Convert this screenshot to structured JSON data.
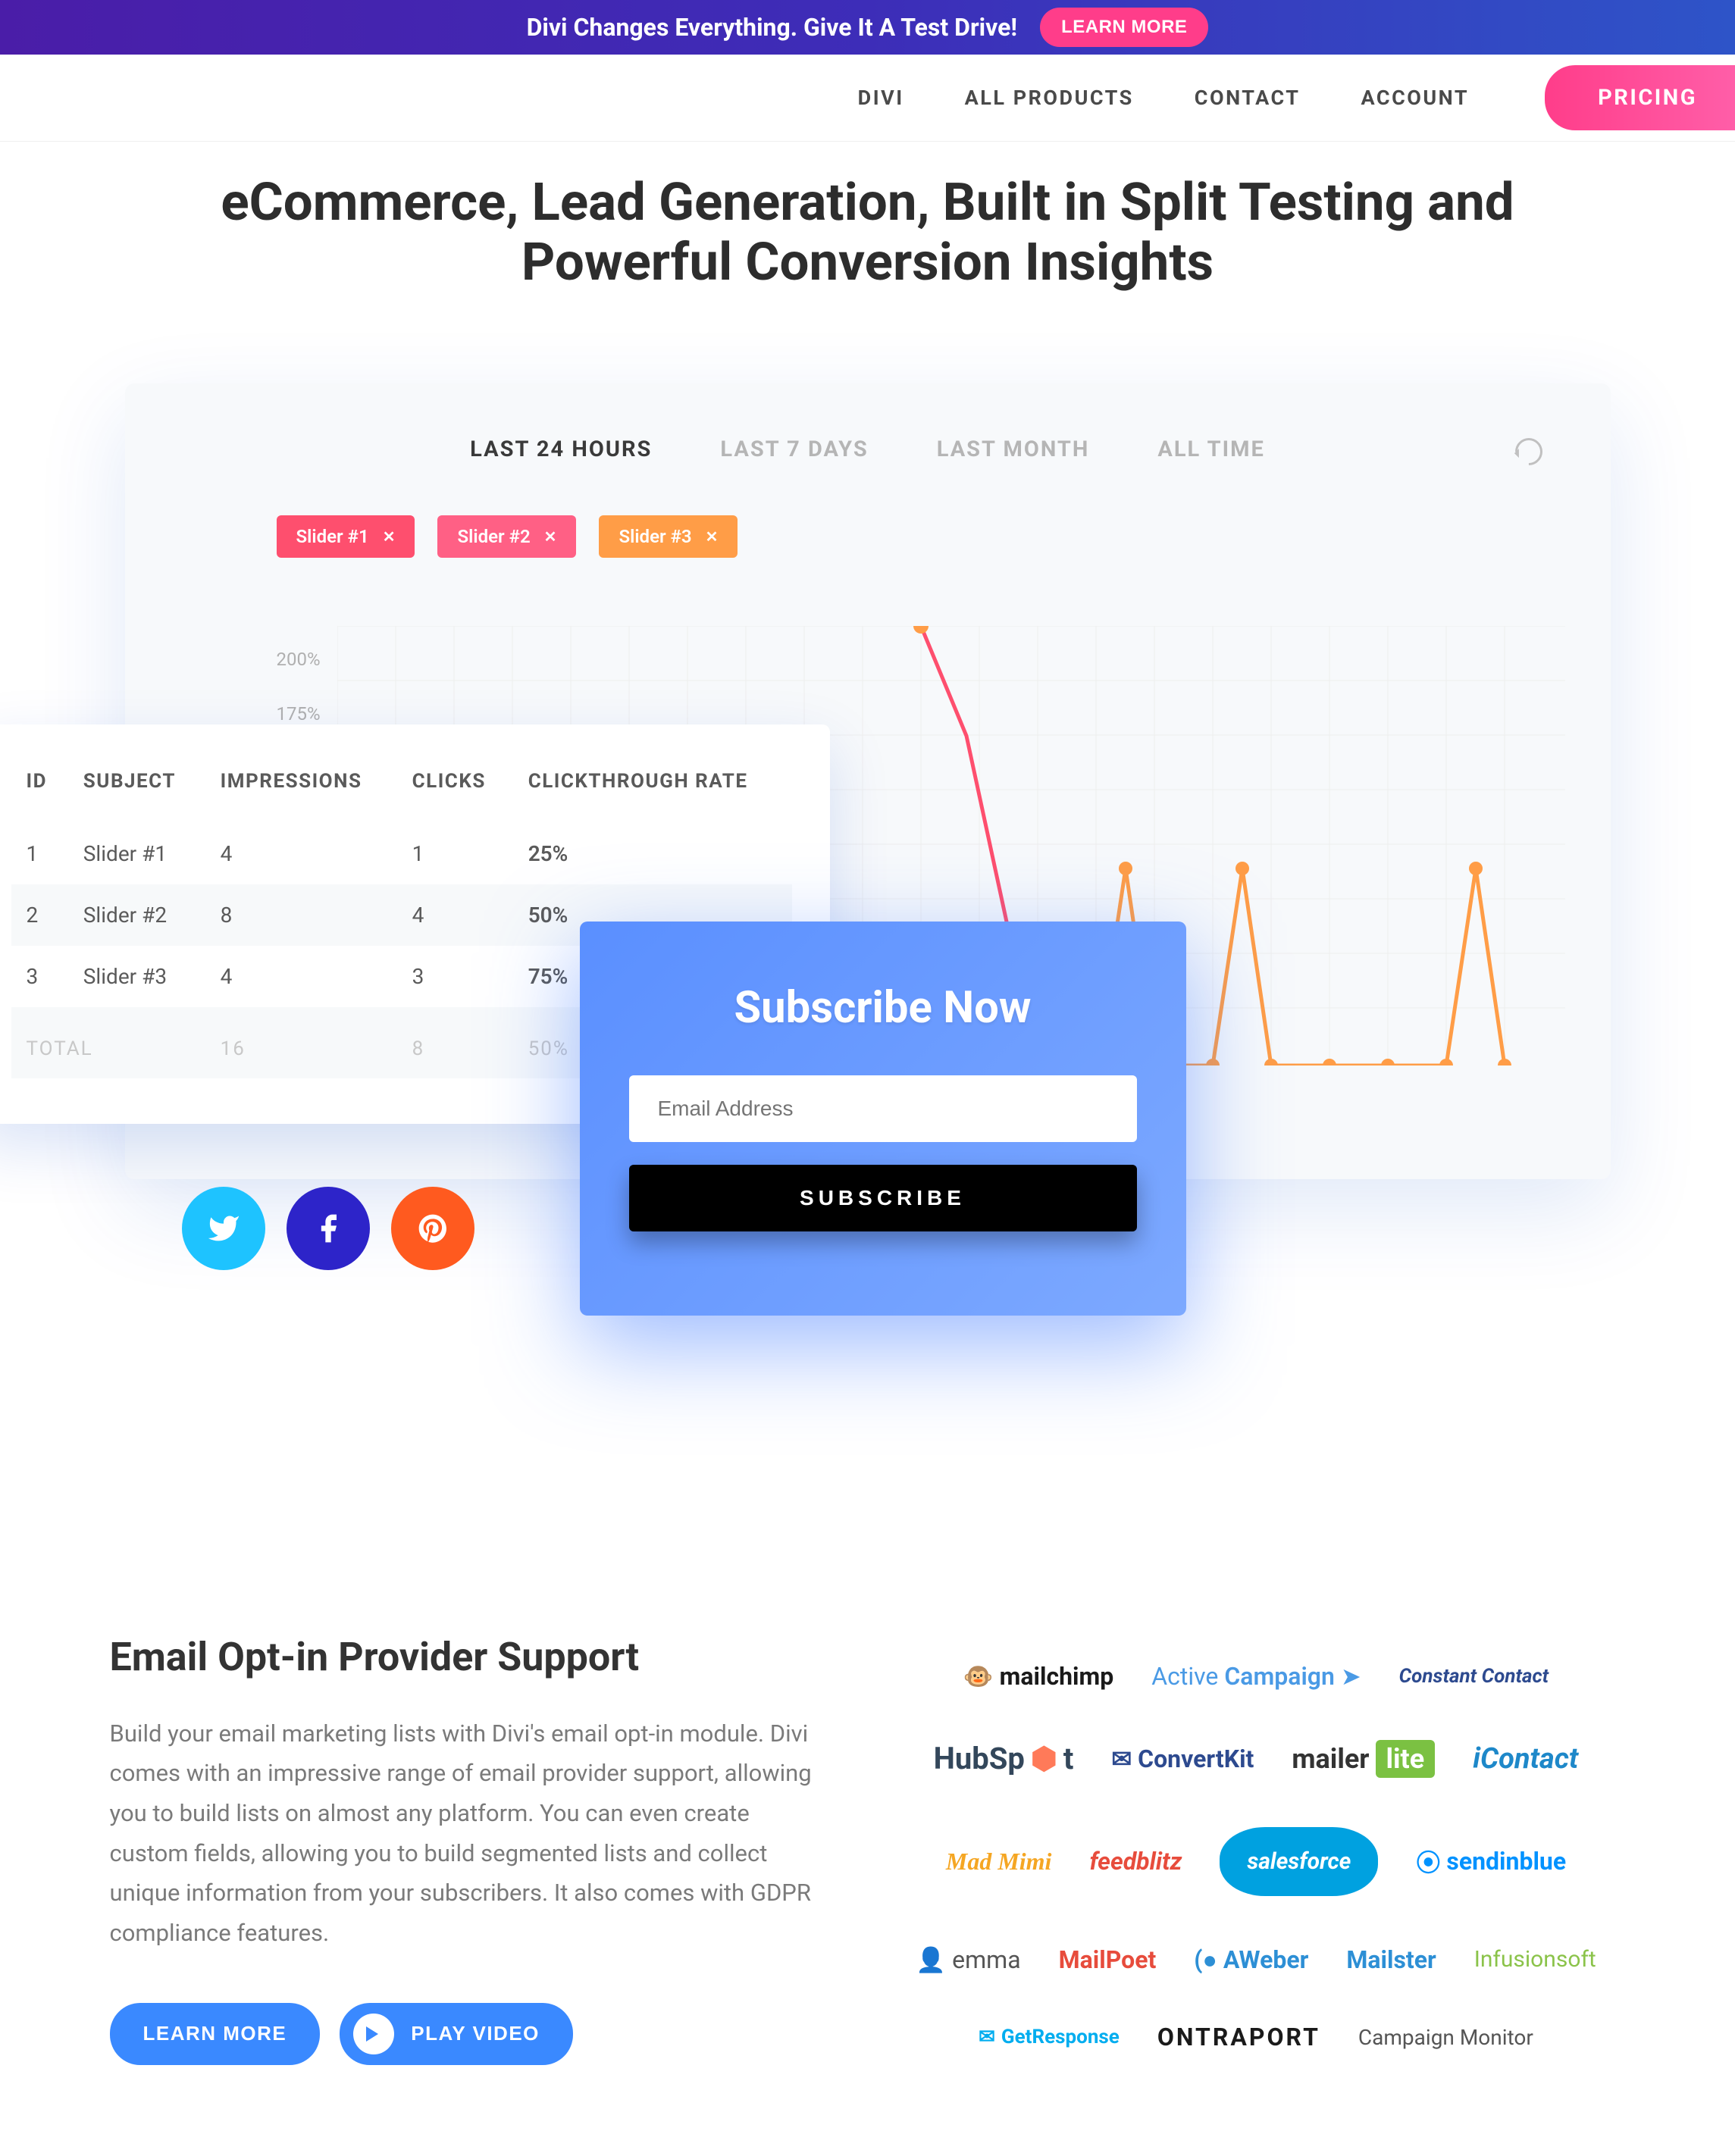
{
  "banner": {
    "text": "Divi Changes Everything. Give It A Test Drive!",
    "cta": "LEARN MORE"
  },
  "nav": {
    "items": [
      "DIVI",
      "ALL PRODUCTS",
      "CONTACT",
      "ACCOUNT"
    ],
    "pricing": "PRICING"
  },
  "hero": {
    "title": "eCommerce, Lead Generation, Built in Split Testing and Powerful Conversion Insights"
  },
  "dashboard": {
    "tabs": [
      "LAST 24 HOURS",
      "LAST 7 DAYS",
      "LAST MONTH",
      "ALL TIME"
    ],
    "active_tab": 0,
    "chips": [
      "Slider #1",
      "Slider #2",
      "Slider #3"
    ],
    "y_ticks": [
      "200%",
      "175%"
    ],
    "table": {
      "headers": [
        "ID",
        "SUBJECT",
        "IMPRESSIONS",
        "CLICKS",
        "CLICKTHROUGH  RATE"
      ],
      "rows": [
        {
          "id": "1",
          "subject": "Slider #1",
          "impressions": "4",
          "clicks": "1",
          "ctr": "25%"
        },
        {
          "id": "2",
          "subject": "Slider #2",
          "impressions": "8",
          "clicks": "4",
          "ctr": "50%"
        },
        {
          "id": "3",
          "subject": "Slider #3",
          "impressions": "4",
          "clicks": "3",
          "ctr": "75%"
        }
      ],
      "total": {
        "label": "TOTAL",
        "impressions": "16",
        "clicks": "8",
        "ctr": "50%"
      }
    }
  },
  "subscribe": {
    "title": "Subscribe Now",
    "placeholder": "Email Address",
    "button": "SUBSCRIBE"
  },
  "section2": {
    "title": "Email Opt-in Provider Support",
    "body": "Build your email marketing lists with Divi's email opt-in module. Divi comes with an impressive range of email provider support, allowing you to build lists on almost any platform. You can even create custom fields, allowing you to build segmented lists and collect unique information from your subscribers. It also comes with GDPR compliance features.",
    "learn": "LEARN MORE",
    "play": "PLAY VIDEO"
  },
  "providers": [
    "mailchimp",
    "ActiveCampaign",
    "Constant Contact",
    "HubSpot",
    "ConvertKit",
    "mailerlite",
    "iContact",
    "Mad Mimi",
    "feedblitz",
    "salesforce",
    "sendinblue",
    "emma",
    "MailPoet",
    "AWeber",
    "Mailster",
    "Infusionsoft",
    "GetResponse",
    "ONTRAPORT",
    "Campaign Monitor"
  ],
  "chart_data": {
    "type": "line",
    "ylim": [
      0,
      200
    ],
    "y_ticks": [
      175,
      200
    ],
    "x_count": 21,
    "series": [
      {
        "name": "Slider #1",
        "color": "#fe4f6e",
        "values": [
          null,
          null,
          null,
          null,
          null,
          null,
          null,
          null,
          null,
          null,
          200,
          150,
          0
        ]
      },
      {
        "name": "Slider #2",
        "color": "#ff6085",
        "values": [
          null,
          null,
          null,
          null,
          null,
          null,
          null,
          null,
          null,
          null,
          140,
          0
        ]
      },
      {
        "name": "Slider #3",
        "color": "#ff9d47",
        "values": [
          null,
          null,
          null,
          null,
          null,
          null,
          null,
          null,
          null,
          null,
          null,
          null,
          null,
          0,
          90,
          0,
          90,
          0,
          0,
          90,
          0
        ]
      }
    ]
  }
}
